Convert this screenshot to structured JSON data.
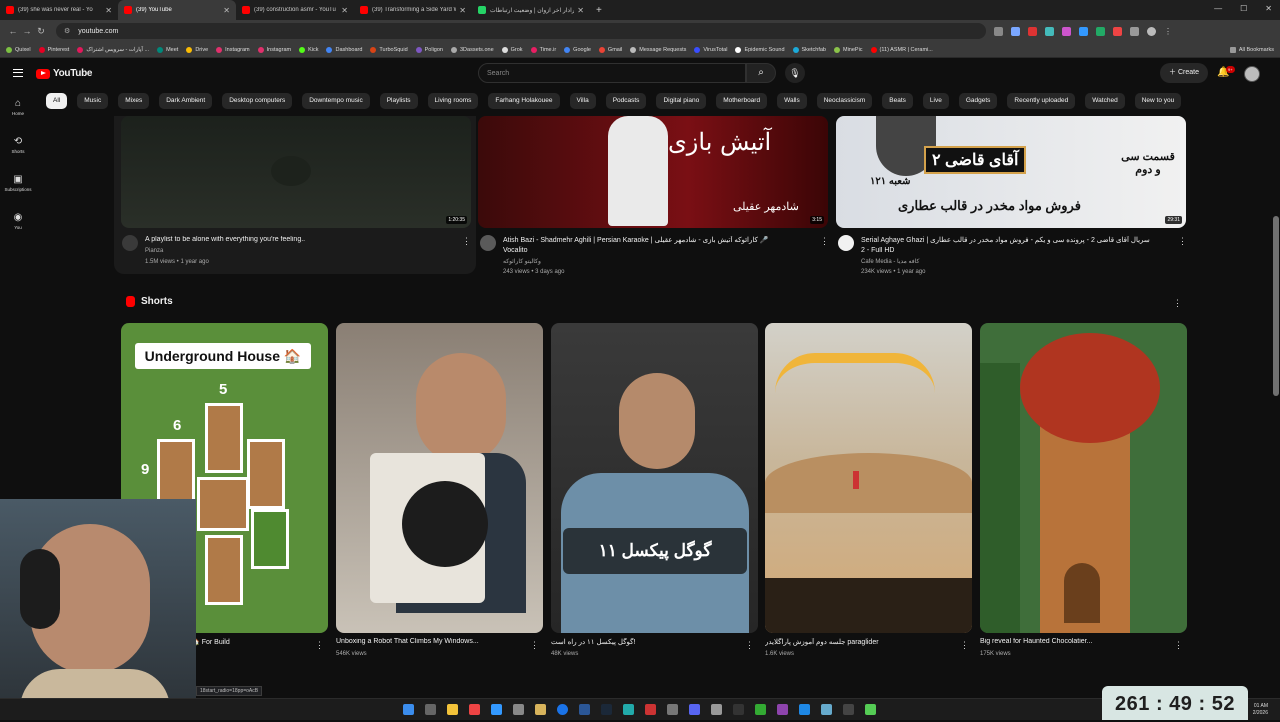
{
  "browser": {
    "tabs": [
      {
        "label": "(39) she was never real - Yo",
        "favicon": "youtube"
      },
      {
        "label": "(39) YouTube",
        "favicon": "youtube",
        "active": true
      },
      {
        "label": "(39) construction asmr - YouTu",
        "favicon": "youtube"
      },
      {
        "label": "(39) Transforming a Side Yard W",
        "favicon": "youtube"
      },
      {
        "label": "رادار اخر آزوان | وضعیت ارتباطات",
        "favicon": "radar"
      }
    ],
    "new_tab": "+",
    "url": "youtube.com",
    "bookmarks": [
      "Quixel",
      "Pinterest",
      "آپارات - سرویس اشتراک ...",
      "Meet",
      "Drive",
      "Instagram",
      "Instagram",
      "Kick",
      "Dashboard",
      "TurboSquid",
      "Poligon",
      "3Dassets.one",
      "Grok",
      "Time.ir",
      "Google",
      "Gmail",
      "Message Requests",
      "VirusTotal",
      "Epidemic Sound",
      "Sketchfab",
      "MinePic",
      "(11) ASMR | Cerami..."
    ],
    "all_bookmarks": "All Bookmarks",
    "status_url": "18start_radio=18pp=oAcB"
  },
  "youtube": {
    "logo_text": "YouTube",
    "search_placeholder": "Search",
    "create_label": "Create",
    "notifications_count": "9+",
    "chips": [
      "All",
      "Music",
      "Mixes",
      "Dark Ambient",
      "Desktop computers",
      "Downtempo music",
      "Playlists",
      "Living rooms",
      "Farhang Holakouee",
      "Villa",
      "Podcasts",
      "Digital piano",
      "Motherboard",
      "Walls",
      "Neoclassicism",
      "Beats",
      "Live",
      "Gadgets",
      "Recently uploaded",
      "Watched",
      "New to you"
    ],
    "sidebar": [
      {
        "label": "Home",
        "icon": "home-icon"
      },
      {
        "label": "Shorts",
        "icon": "shorts-icon"
      },
      {
        "label": "Subscriptions",
        "icon": "subscriptions-icon"
      },
      {
        "label": "You",
        "icon": "you-icon"
      }
    ],
    "videos": [
      {
        "title": "A playlist to be alone with everything you're feeling..",
        "channel": "Pianza",
        "meta": "1.5M views  •  1 year ago",
        "duration": "1:20:35"
      },
      {
        "title": "Atish Bazi - Shadmehr Aghili | Persian Karaoke | کارائوکه آتیش بازی - شادمهر عقیلی 🎤",
        "channel": "Vocalito",
        "channel_sub": "وکالیتو کارائوکه",
        "meta": "243 views  •  3 days ago",
        "duration": "3:15",
        "thumb_text_1": "آتیش بازی",
        "thumb_text_2": "شادمهر عقیلی"
      },
      {
        "title": "Serial Aghaye Ghazi | سریال آقای قاضی 2 - پرونده سی و یکم - فروش مواد مخدر در قالب عطاری",
        "title_line2": "2 - Full HD",
        "channel": "Cafe Media - کافه مدیا",
        "meta": "234K views  •  1 year ago",
        "duration": "29:31",
        "thumb_text_1": "قسمت سی و دوم",
        "thumb_text_2": "آقای قاضی ۲",
        "thumb_text_3": "شعبه ۱۲۱",
        "thumb_text_4": "فروش مواد مخدر در قالب عطاری"
      }
    ],
    "shorts_heading": "Shorts",
    "shorts": [
      {
        "title": "Underground House🏠 For Build",
        "views": "",
        "overlay": "Underground House 🏠",
        "numbers": [
          "5",
          "6",
          "9"
        ]
      },
      {
        "title": "Unboxing a Robot That Climbs My Windows...",
        "views": "546K views"
      },
      {
        "title": "گوگل پیکسل ۱۱ در راه است!",
        "views": "48K views",
        "overlay": "گوگل پیکسل ۱۱"
      },
      {
        "title": "جلسه دوم آموزش پاراگلایدر paraglider",
        "views": "1.6K views"
      },
      {
        "title": "Big reveal for Haunted Chocolatier...",
        "views": "175K views"
      }
    ]
  },
  "overlay": {
    "timer": "261 : 49 : 52",
    "clock_time": "01 AM",
    "clock_date": "2/2026"
  },
  "colors": {
    "yt_red": "#ff0000",
    "background": "#0f0f0f",
    "timer_bg": "#d8e6e3"
  }
}
